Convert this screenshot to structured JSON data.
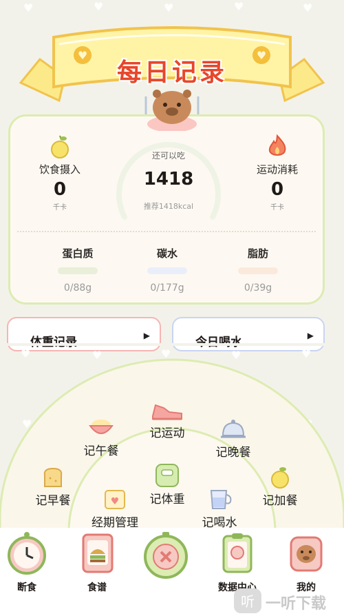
{
  "banner": {
    "title": "每日记录"
  },
  "summary": {
    "intake": {
      "label": "饮食摄入",
      "value": "0",
      "unit": "千卡"
    },
    "burn": {
      "label": "运动消耗",
      "value": "0",
      "unit": "千卡"
    },
    "remaining": {
      "label": "还可以吃",
      "value": "1418",
      "recommend": "推荐1418kcal"
    },
    "macros": [
      {
        "name": "蛋白质",
        "value": "0/88g",
        "color": "#e9efd8"
      },
      {
        "name": "碳水",
        "value": "0/177g",
        "color": "#eaeefb"
      },
      {
        "name": "脂肪",
        "value": "0/39g",
        "color": "#fbeadb"
      }
    ]
  },
  "cards": {
    "weight": {
      "title": "体重记录"
    },
    "water": {
      "title": "今日喝水"
    }
  },
  "menu": {
    "items": [
      {
        "label": "记运动"
      },
      {
        "label": "记午餐"
      },
      {
        "label": "记晚餐"
      },
      {
        "label": "记体重"
      },
      {
        "label": "记早餐"
      },
      {
        "label": "记加餐"
      },
      {
        "label": "经期管理"
      },
      {
        "label": "记喝水"
      }
    ]
  },
  "nav": {
    "items": [
      {
        "label": "断食"
      },
      {
        "label": "食谱"
      },
      {
        "label": ""
      },
      {
        "label": "数据中心"
      },
      {
        "label": "我的"
      }
    ]
  },
  "watermark": {
    "text": "一听下载"
  },
  "colors": {
    "accent": "#e8462a",
    "green": "#dcecb2",
    "background": "#f3f2ea"
  }
}
